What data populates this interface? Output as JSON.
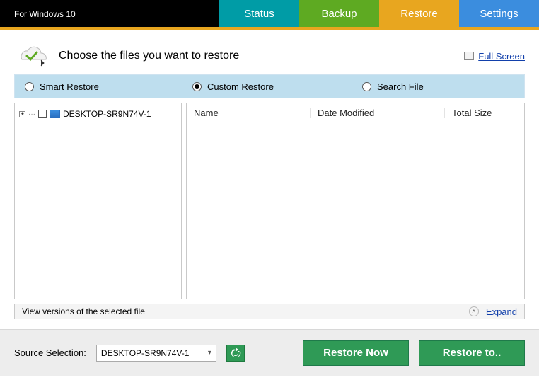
{
  "header": {
    "subtitle": "For Windows 10",
    "nav": {
      "status": "Status",
      "backup": "Backup",
      "restore": "Restore",
      "settings": "Settings"
    }
  },
  "top": {
    "title": "Choose the files you want to restore",
    "fullscreen": "Full Screen"
  },
  "modes": {
    "smart": "Smart Restore",
    "custom": "Custom Restore",
    "search": "Search File",
    "selected": "custom"
  },
  "tree": {
    "root": "DESKTOP-SR9N74V-1"
  },
  "columns": {
    "name": "Name",
    "date": "Date Modified",
    "size": "Total Size"
  },
  "versions": {
    "label": "View versions of the selected file",
    "expand": "Expand"
  },
  "bottom": {
    "source_label": "Source Selection:",
    "source_value": "DESKTOP-SR9N74V-1",
    "restore_now": "Restore Now",
    "restore_to": "Restore to.."
  }
}
